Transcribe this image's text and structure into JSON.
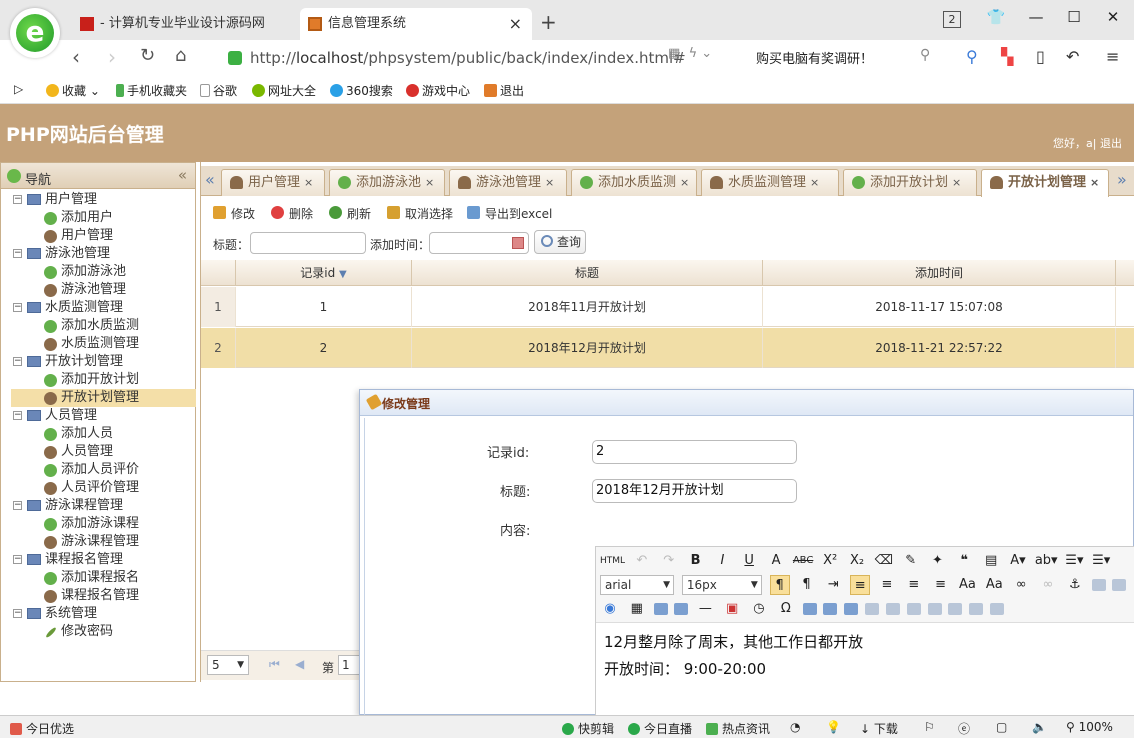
{
  "browser": {
    "tabs": [
      {
        "title": "- 计算机专业毕业设计源码网"
      },
      {
        "title": "信息管理系统"
      }
    ],
    "tab_count": "2",
    "url_scheme": "http://",
    "url_host": "localhost",
    "url_path": "/phpsystem/public/back/index/index.html#",
    "search_suggestion": "购买电脑有奖调研！",
    "bookmarks": [
      "收藏",
      "手机收藏夹",
      "谷歌",
      "网址大全",
      "360搜索",
      "游戏中心",
      "退出"
    ]
  },
  "app": {
    "title": "PHP网站后台管理",
    "welcome": "您好，a| 退出"
  },
  "nav": {
    "title": "导航",
    "groups": [
      {
        "label": "用户管理",
        "items": [
          {
            "label": "添加用户",
            "icon": "add-icon"
          },
          {
            "label": "用户管理",
            "icon": "user-icon"
          }
        ]
      },
      {
        "label": "游泳池管理",
        "items": [
          {
            "label": "添加游泳池",
            "icon": "add-icon"
          },
          {
            "label": "游泳池管理",
            "icon": "user-icon"
          }
        ]
      },
      {
        "label": "水质监测管理",
        "items": [
          {
            "label": "添加水质监测",
            "icon": "add-icon"
          },
          {
            "label": "水质监测管理",
            "icon": "user-icon"
          }
        ]
      },
      {
        "label": "开放计划管理",
        "items": [
          {
            "label": "添加开放计划",
            "icon": "add-icon"
          },
          {
            "label": "开放计划管理",
            "icon": "user-icon",
            "selected": true
          }
        ]
      },
      {
        "label": "人员管理",
        "items": [
          {
            "label": "添加人员",
            "icon": "add-icon"
          },
          {
            "label": "人员管理",
            "icon": "user-icon"
          },
          {
            "label": "添加人员评价",
            "icon": "add-icon"
          },
          {
            "label": "人员评价管理",
            "icon": "user-icon"
          }
        ]
      },
      {
        "label": "游泳课程管理",
        "items": [
          {
            "label": "添加游泳课程",
            "icon": "add-icon"
          },
          {
            "label": "游泳课程管理",
            "icon": "user-icon"
          }
        ]
      },
      {
        "label": "课程报名管理",
        "items": [
          {
            "label": "添加课程报名",
            "icon": "add-icon"
          },
          {
            "label": "课程报名管理",
            "icon": "user-icon"
          }
        ]
      },
      {
        "label": "系统管理",
        "items": [
          {
            "label": "修改密码",
            "icon": "pen-icon"
          }
        ]
      }
    ]
  },
  "content_tabs": [
    {
      "label": "用户管理",
      "icon": "user-icon"
    },
    {
      "label": "添加游泳池",
      "icon": "add-icon"
    },
    {
      "label": "游泳池管理",
      "icon": "user-icon"
    },
    {
      "label": "添加水质监测",
      "icon": "add-icon"
    },
    {
      "label": "水质监测管理",
      "icon": "user-icon"
    },
    {
      "label": "添加开放计划",
      "icon": "add-icon"
    },
    {
      "label": "开放计划管理",
      "icon": "user-icon",
      "active": true
    }
  ],
  "toolbar": {
    "edit": "修改",
    "delete": "删除",
    "refresh": "刷新",
    "deselect": "取消选择",
    "export": "导出到excel"
  },
  "filter": {
    "title_label": "标题：",
    "time_label": "添加时间：",
    "search": "查询"
  },
  "grid": {
    "columns": [
      "记录id",
      "标题",
      "添加时间"
    ],
    "rows": [
      {
        "rownum": "1",
        "id": "1",
        "title": "2018年11月开放计划",
        "time": "2018-11-17 15:07:08"
      },
      {
        "rownum": "2",
        "id": "2",
        "title": "2018年12月开放计划",
        "time": "2018-11-21 22:57:22",
        "selected": true
      }
    ]
  },
  "pager": {
    "page_size": "5",
    "page_label": "第",
    "page": "1"
  },
  "dialog": {
    "title": "修改管理",
    "id_label": "记录id:",
    "id_value": "2",
    "title_label": "标题:",
    "title_value": "2018年12月开放计划",
    "content_label": "内容:",
    "editor": {
      "html_btn": "HTML",
      "font": "arial",
      "size": "16px",
      "content_lines": [
        "12月整月除了周末，其他工作日都开放",
        "开放时间： 9:00-20:00"
      ]
    }
  },
  "statusbar": [
    "今日优选",
    "快剪辑",
    "今日直播",
    "热点资讯",
    "下载",
    "100%"
  ],
  "colors": {
    "header": "#c4a27a",
    "selected_row": "#f1dea7",
    "accent": "#5d7fb0"
  }
}
